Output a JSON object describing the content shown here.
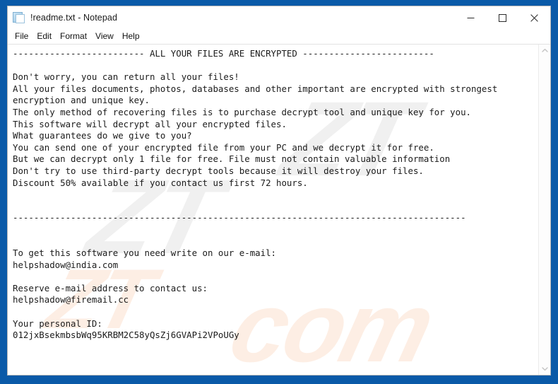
{
  "window": {
    "title": "!readme.txt - Notepad",
    "icon": "notepad-document-icon",
    "controls": {
      "minimize": "Minimize",
      "maximize": "Maximize",
      "close": "Close"
    }
  },
  "menubar": {
    "items": [
      {
        "label": "File"
      },
      {
        "label": "Edit"
      },
      {
        "label": "Format"
      },
      {
        "label": "View"
      },
      {
        "label": "Help"
      }
    ]
  },
  "scrollbar": {
    "up_arrow": "scroll-up",
    "down_arrow": "scroll-down"
  },
  "document": {
    "filename": "!readme.txt",
    "body": "------------------------- ALL YOUR FILES ARE ENCRYPTED -------------------------\n\nDon't worry, you can return all your files!\nAll your files documents, photos, databases and other important are encrypted with strongest\nencryption and unique key.\nThe only method of recovering files is to purchase decrypt tool and unique key for you.\nThis software will decrypt all your encrypted files.\nWhat guarantees do we give to you?\nYou can send one of your encrypted file from your PC and we decrypt it for free.\nBut we can decrypt only 1 file for free. File must not contain valuable information\nDon't try to use third-party decrypt tools because it will destroy your files.\nDiscount 50% available if you contact us first 72 hours.\n\n\n--------------------------------------------------------------------------------------\n\n\nTo get this software you need write on our e-mail:\nhelpshadow@india.com\n\nReserve e-mail address to contact us:\nhelpshadow@firemail.cc\n\nYour personal ID:\n012jxBsekmbsbWq95KRBM2C58yQsZj6GVAPi2VPoUGy",
    "headline": "ALL YOUR FILES ARE ENCRYPTED",
    "contact_email_primary": "helpshadow@india.com",
    "contact_email_reserve": "helpshadow@firemail.cc",
    "personal_id": "012jxBsekmbsbWq95KRBM2C58yQsZj6GVAPi2VPoUGy",
    "discount_percent": "50%",
    "discount_hours": "72"
  },
  "watermark": {
    "gray_text": "ZT",
    "peach_text": "com",
    "gray_color": "#f0f0f0",
    "peach_color": "#fdeee4"
  },
  "colors": {
    "desktop_blue": "#0a5aa8",
    "window_bg": "#ffffff",
    "text": "#1b1b1b"
  }
}
